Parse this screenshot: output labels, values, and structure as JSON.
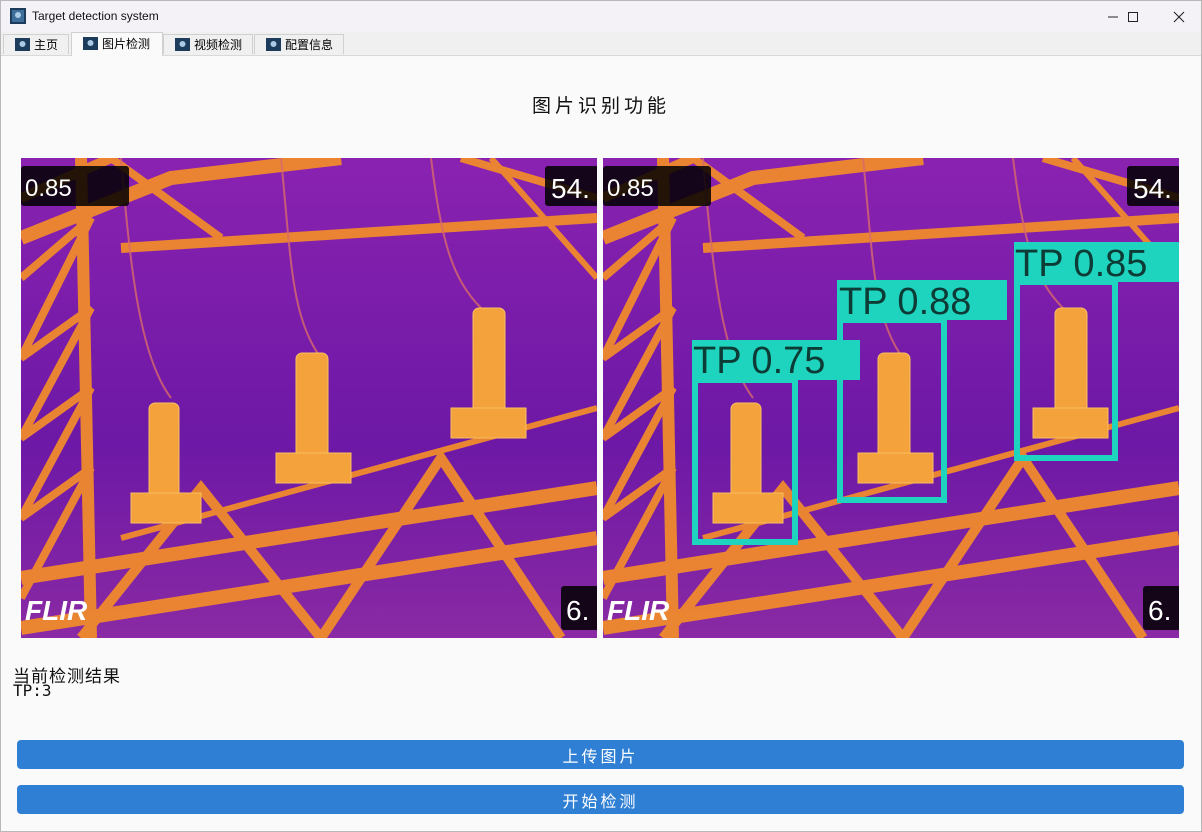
{
  "window": {
    "title": "Target detection system",
    "tabs": [
      {
        "label": "主页",
        "icon": "app-icon"
      },
      {
        "label": "图片检测",
        "icon": "app-icon"
      },
      {
        "label": "视频检测",
        "icon": "app-icon"
      },
      {
        "label": "配置信息",
        "icon": "app-icon"
      }
    ],
    "active_tab": "图片检测"
  },
  "page": {
    "title": "图片识别功能"
  },
  "images": {
    "original": {
      "overlay_top_left": "0.85",
      "overlay_top_right": "54.",
      "overlay_bottom_right": "6.",
      "logo": "FLIR"
    },
    "detected": {
      "overlay_top_left": "0.85",
      "overlay_top_right": "54.",
      "overlay_bottom_right": "6.",
      "logo": "FLIR",
      "box_color": "#1fd4be",
      "detections": [
        {
          "label": "TP 0.75"
        },
        {
          "label": "TP 0.88"
        },
        {
          "label": "TP 0.85"
        }
      ]
    }
  },
  "result": {
    "heading": "当前检测结果",
    "value": "TP:3"
  },
  "buttons": {
    "upload": "上传图片",
    "start": "开始检测"
  },
  "colors": {
    "button_blue": "#2f7fd4",
    "thermal_background": "#7a18a8",
    "thermal_structure": "#f08a2c"
  }
}
